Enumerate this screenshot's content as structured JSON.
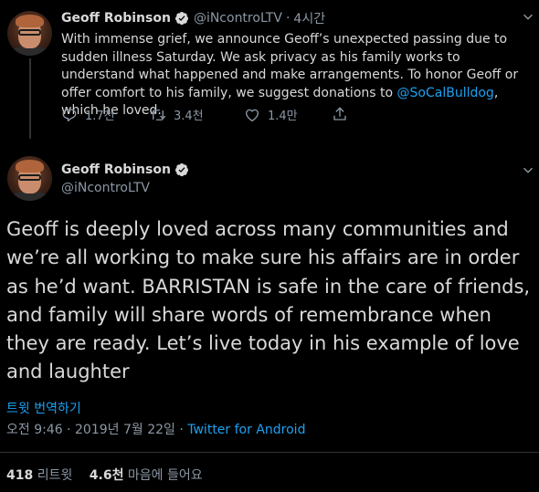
{
  "tweet1": {
    "author_name": "Geoff Robinson",
    "handle": "@iNcontroLTV",
    "separator": "·",
    "time_ago": "4시간",
    "text_before_mention": "With immense grief, we announce Geoff’s unexpected passing due to sudden illness Saturday. We ask privacy as his family works to understand what happened and make arrangements. To honor Geoff or offer comfort to his family, we suggest donations to ",
    "mention": "@SoCalBulldog",
    "text_after_mention": ", which he loved.",
    "reply_count": "1.7천",
    "retweet_count": "3.4천",
    "like_count": "1.4만",
    "icons": [
      "reply-icon",
      "retweet-icon",
      "like-icon",
      "share-icon",
      "chevron-down-icon",
      "verified-badge-icon"
    ]
  },
  "tweet2": {
    "author_name": "Geoff Robinson",
    "handle": "@iNcontroLTV",
    "text": "Geoff is deeply loved across many communities and we’re all working to make sure his affairs are in order as he’d want. BARRISTAN is safe in the care of friends, and family will share words of remembrance when they are ready. Let’s live today in his example of love and laughter",
    "translate_label": "트윗 번역하기",
    "timestamp": "오전 9:46 · 2019년 7월 22일",
    "meta_separator": " · ",
    "client": "Twitter for Android",
    "retweets_value": "418",
    "retweets_label": "리트윗",
    "likes_value": "4.6천",
    "likes_label": "마음에 들어요"
  },
  "colors": {
    "background": "#000000",
    "text": "#d9d9d9",
    "secondary": "#8b98a5",
    "accent": "#1da1f2",
    "divider": "#2f3336"
  }
}
